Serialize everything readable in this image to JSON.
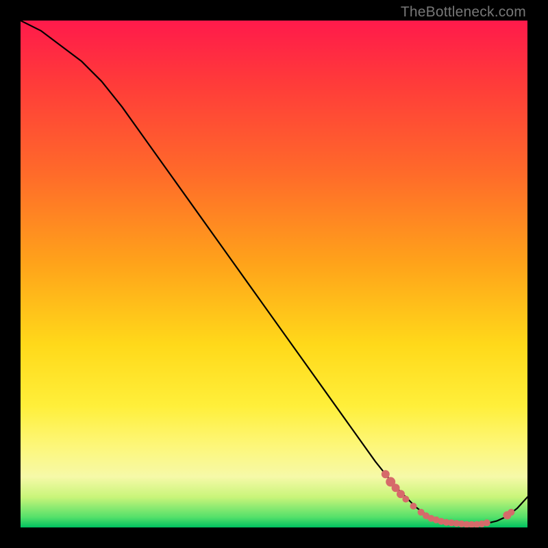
{
  "watermark": "TheBottleneck.com",
  "colors": {
    "curve": "#000000",
    "marker_fill": "#d66a6a",
    "marker_stroke": "#c05050"
  },
  "chart_data": {
    "type": "line",
    "title": "",
    "xlabel": "",
    "ylabel": "",
    "xlim": [
      0,
      100
    ],
    "ylim": [
      0,
      100
    ],
    "series": [
      {
        "name": "curve",
        "x": [
          0,
          4,
          8,
          12,
          16,
          20,
          25,
          30,
          35,
          40,
          45,
          50,
          55,
          60,
          65,
          70,
          74,
          78,
          80,
          82,
          84,
          86,
          88,
          90,
          92,
          94,
          96,
          98,
          100
        ],
        "y": [
          100,
          98,
          95,
          92,
          88,
          83,
          76,
          69,
          62,
          55,
          48,
          41,
          34,
          27,
          20,
          13,
          8,
          4,
          2.5,
          1.6,
          1.1,
          0.8,
          0.6,
          0.6,
          0.8,
          1.3,
          2.2,
          3.8,
          6
        ]
      }
    ],
    "markers": {
      "comment": "salmon dots cluster near trough + one outlier right slope",
      "points": [
        {
          "x": 72.0,
          "y": 10.5,
          "r": 6
        },
        {
          "x": 73.0,
          "y": 9.0,
          "r": 7
        },
        {
          "x": 74.0,
          "y": 7.8,
          "r": 6
        },
        {
          "x": 75.0,
          "y": 6.6,
          "r": 6
        },
        {
          "x": 76.0,
          "y": 5.6,
          "r": 5
        },
        {
          "x": 77.5,
          "y": 4.2,
          "r": 5
        },
        {
          "x": 79.0,
          "y": 3.0,
          "r": 5
        },
        {
          "x": 80.0,
          "y": 2.3,
          "r": 5
        },
        {
          "x": 81.0,
          "y": 1.8,
          "r": 5
        },
        {
          "x": 82.0,
          "y": 1.5,
          "r": 5
        },
        {
          "x": 83.0,
          "y": 1.2,
          "r": 5
        },
        {
          "x": 84.0,
          "y": 1.0,
          "r": 5
        },
        {
          "x": 85.0,
          "y": 0.9,
          "r": 5
        },
        {
          "x": 86.0,
          "y": 0.8,
          "r": 5
        },
        {
          "x": 87.0,
          "y": 0.7,
          "r": 5
        },
        {
          "x": 88.0,
          "y": 0.6,
          "r": 5
        },
        {
          "x": 89.0,
          "y": 0.6,
          "r": 5
        },
        {
          "x": 90.0,
          "y": 0.6,
          "r": 5
        },
        {
          "x": 91.0,
          "y": 0.7,
          "r": 5
        },
        {
          "x": 92.0,
          "y": 0.9,
          "r": 5
        },
        {
          "x": 96.0,
          "y": 2.4,
          "r": 6
        },
        {
          "x": 96.8,
          "y": 3.0,
          "r": 5
        }
      ]
    }
  }
}
